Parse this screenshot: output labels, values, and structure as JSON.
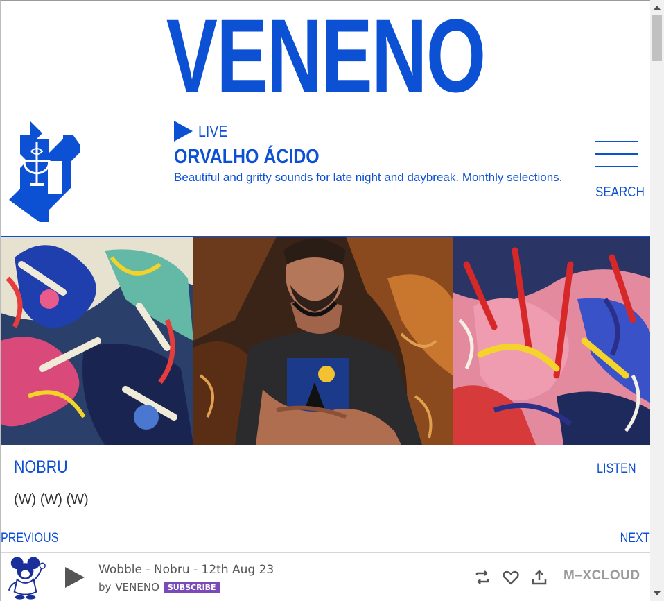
{
  "brand": {
    "wordmark": "VENENO",
    "color": "#0c50d4"
  },
  "now_playing": {
    "live_label": "LIVE",
    "show_title": "ORVALHO ÁCIDO",
    "description": "Beautiful and gritty sounds for late night and daybreak. Monthly selections."
  },
  "nav": {
    "search_label": "SEARCH",
    "menu_icon": "hamburger-icon"
  },
  "mix": {
    "title": "NOBRU",
    "listen_label": "LISTEN",
    "subtitle": "(W) (W) (W)",
    "previous_label": "PREVIOUS",
    "next_label": "NEXT"
  },
  "player": {
    "track_title": "Wobble - Nobru - 12th Aug 23",
    "by_label": "by",
    "owner": "VENENO",
    "subscribe_label": "SUBSCRIBE",
    "brand": "M–XCLOUD",
    "icons": [
      "repost-icon",
      "heart-icon",
      "share-icon"
    ],
    "subscribe_color": "#7a4bb8"
  }
}
